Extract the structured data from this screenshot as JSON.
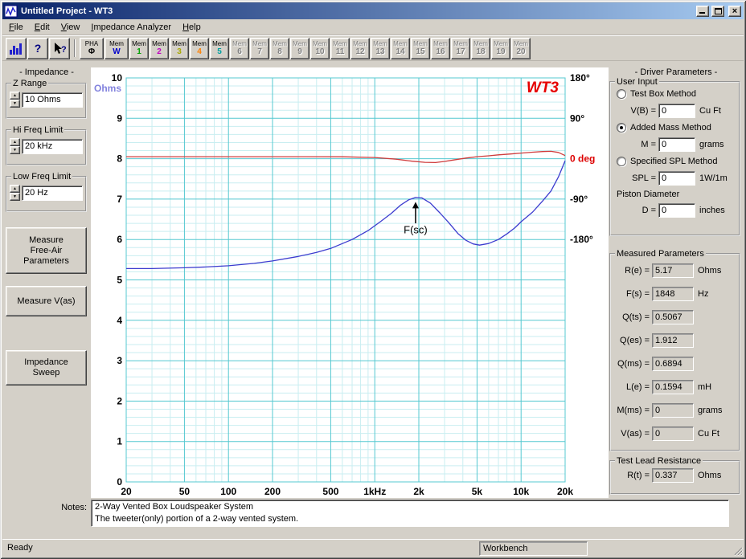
{
  "window": {
    "title": "Untitled Project - WT3"
  },
  "menu": {
    "items": [
      {
        "label": "File",
        "underline": 0
      },
      {
        "label": "Edit",
        "underline": 0
      },
      {
        "label": "View",
        "underline": 0
      },
      {
        "label": "Impedance Analyzer",
        "underline": 0
      },
      {
        "label": "Help",
        "underline": 0
      }
    ]
  },
  "toolbar": {
    "help_glyph": "?",
    "pha_button": {
      "line1": "PHA",
      "line2": "Φ"
    },
    "mem_w_button": {
      "line1": "Mem",
      "line2": "W",
      "color": "#0000cc"
    },
    "mem_label": "Mem",
    "mem_buttons": [
      {
        "num": "1",
        "color": "#00a000",
        "active": true
      },
      {
        "num": "2",
        "color": "#c000c0",
        "active": true
      },
      {
        "num": "3",
        "color": "#a8a800",
        "active": true
      },
      {
        "num": "4",
        "color": "#ff8000",
        "active": true
      },
      {
        "num": "5",
        "color": "#00a0a0",
        "active": true
      },
      {
        "num": "6",
        "active": false
      },
      {
        "num": "7",
        "active": false
      },
      {
        "num": "8",
        "active": false
      },
      {
        "num": "9",
        "active": false
      },
      {
        "num": "10",
        "active": false
      },
      {
        "num": "11",
        "active": false
      },
      {
        "num": "12",
        "active": false
      },
      {
        "num": "13",
        "active": false
      },
      {
        "num": "14",
        "active": false
      },
      {
        "num": "15",
        "active": false
      },
      {
        "num": "16",
        "active": false
      },
      {
        "num": "17",
        "active": false
      },
      {
        "num": "18",
        "active": false
      },
      {
        "num": "19",
        "active": false
      },
      {
        "num": "20",
        "active": false
      }
    ]
  },
  "left_panel": {
    "title": "- Impedance -",
    "groups": [
      {
        "name": "z-range",
        "label": "Z Range",
        "value": "10 Ohms"
      },
      {
        "name": "hi-freq-limit",
        "label": "Hi Freq Limit",
        "value": "20 kHz"
      },
      {
        "name": "low-freq-limit",
        "label": "Low Freq Limit",
        "value": "20 Hz"
      }
    ],
    "buttons": [
      {
        "name": "measure-free-air-button",
        "label": "Measure\nFree-Air\nParameters"
      },
      {
        "name": "measure-vas-button",
        "label": "Measure V(as)"
      },
      {
        "name": "impedance-sweep-button",
        "label": "Impedance\nSweep"
      }
    ]
  },
  "chart_data": {
    "type": "line",
    "logo": "WT3",
    "logo_color": "#e60000",
    "x_scale": "log",
    "x_range": [
      20,
      20000
    ],
    "x_ticks": [
      {
        "value": 20,
        "label": "20"
      },
      {
        "value": 50,
        "label": "50"
      },
      {
        "value": 100,
        "label": "100"
      },
      {
        "value": 200,
        "label": "200"
      },
      {
        "value": 500,
        "label": "500"
      },
      {
        "value": 1000,
        "label": "1kHz"
      },
      {
        "value": 2000,
        "label": "2k"
      },
      {
        "value": 5000,
        "label": "5k"
      },
      {
        "value": 10000,
        "label": "10k"
      },
      {
        "value": 20000,
        "label": "20k"
      }
    ],
    "y_left": {
      "label": "Ohms",
      "label_color": "#8282dd",
      "min": 0,
      "max": 10,
      "ticks": [
        0,
        1,
        2,
        3,
        4,
        5,
        6,
        7,
        8,
        9,
        10
      ]
    },
    "y_right": {
      "zero_at": 8,
      "deg_per_div": 90,
      "entries": [
        {
          "pos": 10,
          "label": "180°"
        },
        {
          "pos": 9,
          "label": "90°"
        },
        {
          "pos": 8,
          "label": "0 deg",
          "color": "#dd0000"
        },
        {
          "pos": 7,
          "label": "-90°"
        },
        {
          "pos": 6,
          "label": "-180°"
        }
      ]
    },
    "grid": {
      "minor": "#c9eef1",
      "major": "#55c8d0"
    },
    "series": [
      {
        "name": "Impedance (Ohms)",
        "color": "#3c3ccf",
        "axis": "left",
        "points": [
          [
            20,
            5.28
          ],
          [
            30,
            5.28
          ],
          [
            50,
            5.3
          ],
          [
            70,
            5.32
          ],
          [
            100,
            5.35
          ],
          [
            150,
            5.41
          ],
          [
            200,
            5.47
          ],
          [
            300,
            5.58
          ],
          [
            400,
            5.68
          ],
          [
            500,
            5.78
          ],
          [
            700,
            6.0
          ],
          [
            900,
            6.22
          ],
          [
            1100,
            6.45
          ],
          [
            1300,
            6.65
          ],
          [
            1500,
            6.85
          ],
          [
            1700,
            6.98
          ],
          [
            1900,
            7.04
          ],
          [
            2100,
            7.03
          ],
          [
            2400,
            6.9
          ],
          [
            2800,
            6.65
          ],
          [
            3200,
            6.42
          ],
          [
            3700,
            6.15
          ],
          [
            4200,
            5.98
          ],
          [
            4700,
            5.89
          ],
          [
            5200,
            5.86
          ],
          [
            6000,
            5.9
          ],
          [
            7000,
            6.0
          ],
          [
            8000,
            6.14
          ],
          [
            9000,
            6.28
          ],
          [
            10000,
            6.44
          ],
          [
            12000,
            6.68
          ],
          [
            14000,
            6.95
          ],
          [
            16000,
            7.2
          ],
          [
            18000,
            7.55
          ],
          [
            20000,
            7.95
          ]
        ]
      },
      {
        "name": "Phase (deg)",
        "color": "#cf3c3c",
        "axis": "right",
        "points": [
          [
            20,
            4.5
          ],
          [
            100,
            4.5
          ],
          [
            300,
            4.5
          ],
          [
            600,
            4.3
          ],
          [
            1000,
            2.7
          ],
          [
            1400,
            -1.0
          ],
          [
            1800,
            -5.5
          ],
          [
            2200,
            -8.0
          ],
          [
            2600,
            -8.5
          ],
          [
            3000,
            -6.0
          ],
          [
            3600,
            -2.0
          ],
          [
            4200,
            1.5
          ],
          [
            5000,
            4.5
          ],
          [
            6000,
            6.5
          ],
          [
            7000,
            8.5
          ],
          [
            8500,
            10.5
          ],
          [
            10000,
            12.5
          ],
          [
            12000,
            14.5
          ],
          [
            14000,
            16.0
          ],
          [
            16000,
            16.5
          ],
          [
            18000,
            14.0
          ],
          [
            20000,
            7.0
          ]
        ]
      }
    ],
    "annotation": {
      "text": "F(sc)",
      "x": 1900,
      "arrow_from": 6.4,
      "arrow_to": 6.93,
      "text_y": 6.15
    }
  },
  "right_panel": {
    "title": "- Driver Parameters -",
    "user_input": {
      "legend": "User Input",
      "rows": [
        {
          "type": "radio",
          "name": "test-box-method",
          "label": "Test Box Method",
          "checked": false
        },
        {
          "type": "field",
          "name": "vb",
          "label": "V(B) =",
          "value": "0",
          "unit": "Cu Ft"
        },
        {
          "type": "radio",
          "name": "added-mass-method",
          "label": "Added Mass Method",
          "checked": true
        },
        {
          "type": "field",
          "name": "m",
          "label": "M =",
          "value": "0",
          "unit": "grams"
        },
        {
          "type": "radio",
          "name": "specified-spl-method",
          "label": "Specified SPL Method",
          "checked": false
        },
        {
          "type": "field",
          "name": "spl",
          "label": "SPL =",
          "value": "0",
          "unit": "1W/1m"
        },
        {
          "type": "label",
          "name": "piston-diameter",
          "label": "Piston Diameter"
        },
        {
          "type": "field",
          "name": "d",
          "label": "D =",
          "value": "0",
          "unit": "inches"
        }
      ]
    },
    "measured": {
      "legend": "Measured Parameters",
      "rows": [
        {
          "name": "re",
          "label": "R(e) =",
          "value": "5.17",
          "unit": "Ohms"
        },
        {
          "name": "fs",
          "label": "F(s) =",
          "value": "1848",
          "unit": "Hz"
        },
        {
          "name": "qts",
          "label": "Q(ts) =",
          "value": "0.5067",
          "unit": ""
        },
        {
          "name": "qes",
          "label": "Q(es) =",
          "value": "1.912",
          "unit": ""
        },
        {
          "name": "qms",
          "label": "Q(ms) =",
          "value": "0.6894",
          "unit": ""
        },
        {
          "name": "le",
          "label": "L(e) =",
          "value": "0.1594",
          "unit": "mH"
        },
        {
          "name": "mms",
          "label": "M(ms) =",
          "value": "0",
          "unit": "grams"
        },
        {
          "name": "vas",
          "label": "V(as) =",
          "value": "0",
          "unit": "Cu Ft"
        }
      ]
    },
    "test_lead": {
      "legend": "Test Lead Resistance",
      "rows": [
        {
          "name": "rt",
          "label": "R(t) =",
          "value": "0.337",
          "unit": "Ohms"
        }
      ]
    }
  },
  "notes": {
    "label": "Notes:",
    "lines": [
      "2-Way Vented Box Loudspeaker System",
      "The tweeter(only) portion of a 2-way vented system."
    ]
  },
  "status": {
    "ready": "Ready",
    "workbench": "Workbench"
  }
}
